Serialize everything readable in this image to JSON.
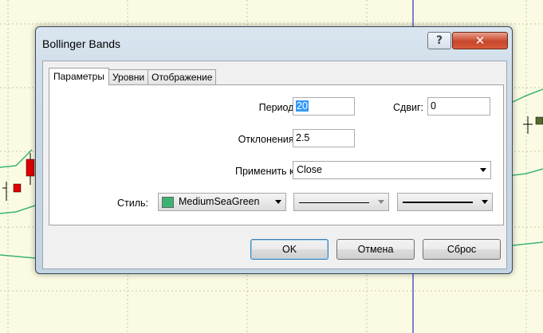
{
  "window": {
    "title": "Bollinger Bands",
    "help_glyph": "?",
    "close_glyph": "✕"
  },
  "tabs": [
    {
      "label": "Параметры",
      "active": true
    },
    {
      "label": "Уровни",
      "active": false
    },
    {
      "label": "Отображение",
      "active": false
    }
  ],
  "form": {
    "period_label": "Период:",
    "period_value": "20",
    "shift_label": "Сдвиг:",
    "shift_value": "0",
    "deviation_label": "Отклонения:",
    "deviation_value": "2.5",
    "apply_label": "Применить к:",
    "apply_value": "Close",
    "style_label": "Стиль:",
    "color_name": "MediumSeaGreen",
    "color_hex": "#3cb371"
  },
  "buttons": {
    "ok": "OK",
    "cancel": "Отмена",
    "reset": "Сброс"
  },
  "colors": {
    "chart_background": "#fbfbe3",
    "band_line": "#3cb371",
    "crosshair": "#0000cc",
    "bear_candle": "#e00000",
    "bull_candle": "#556b2f"
  }
}
